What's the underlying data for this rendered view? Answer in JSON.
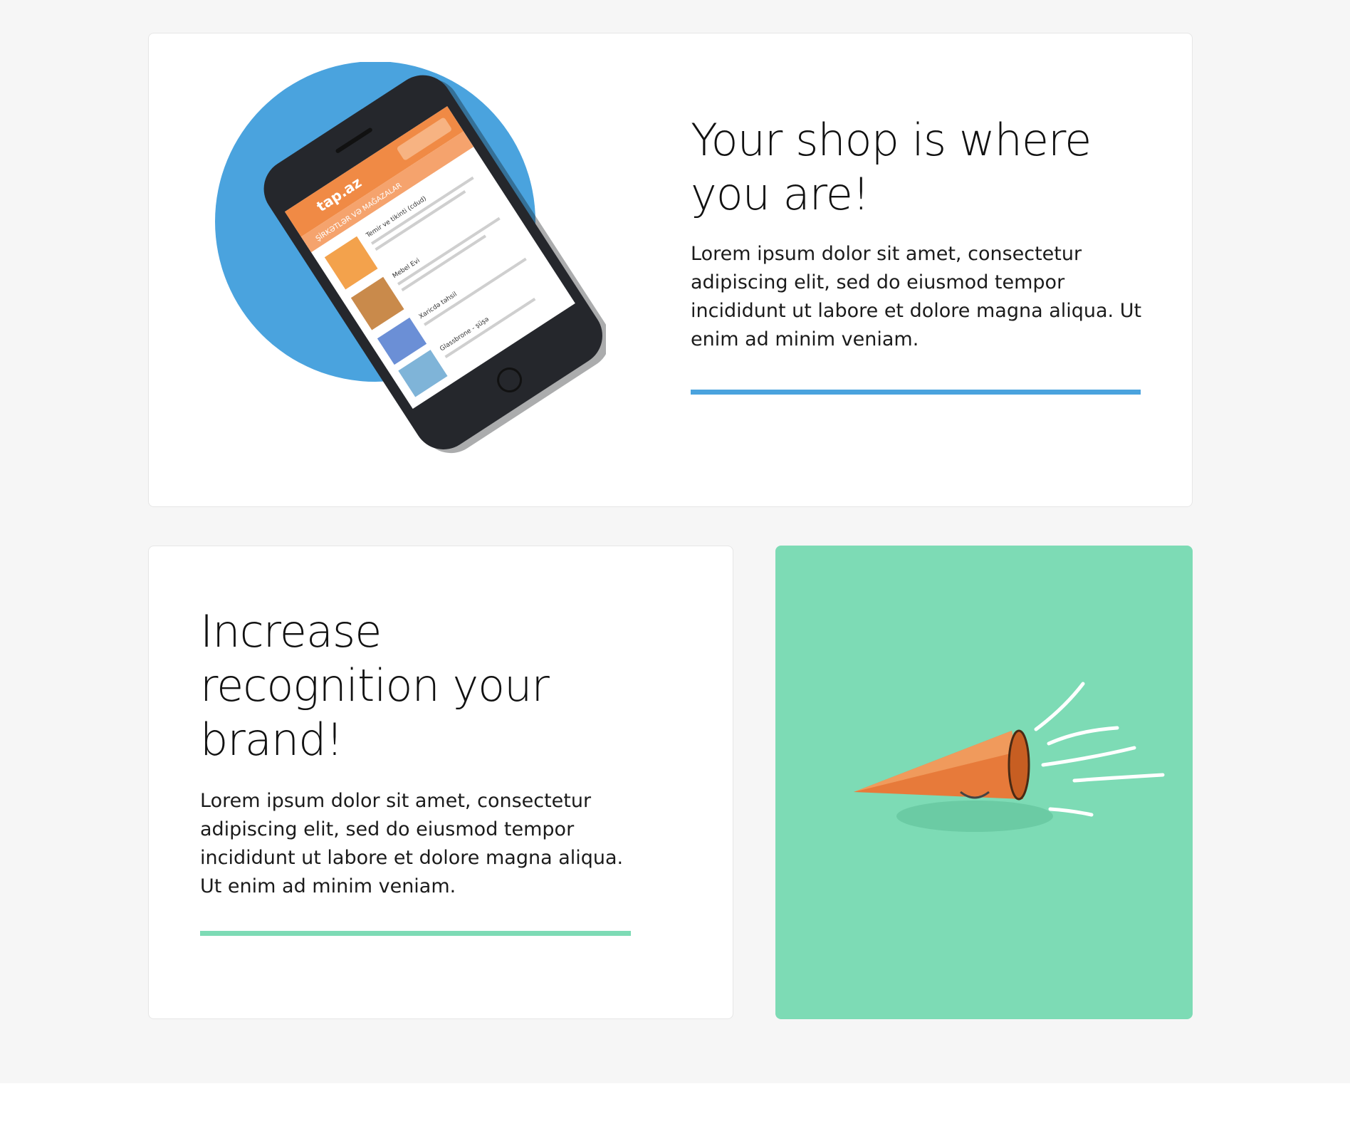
{
  "sections": {
    "shop": {
      "title": "Your shop is where you are!",
      "body": "Lorem ipsum dolor sit amet, consectetur adipiscing elit, sed do eiusmod tempor incididunt ut labore et dolore magna aliqua. Ut enim ad minim veniam.",
      "accent_color": "#4aa3de",
      "illustration": "phone-app-illustration",
      "phone_screen": {
        "brand": "tap.az",
        "nav_label": "ŞİRKƏTLƏR VƏ MAĞAZALAR",
        "listing_1": "Temir ve tikinti (cdud)",
        "listing_2": "Mebel Evi",
        "listing_3": "Xaricdə təhsil",
        "listing_4": "Glassbrone - şüşə"
      }
    },
    "brand": {
      "title": "Increase recognition your brand!",
      "body": "Lorem ipsum dolor sit amet, consectetur adipiscing elit, sed do eiusmod tempor incididunt ut labore et dolore magna aliqua. Ut enim ad minim veniam.",
      "accent_color": "#7ddbb5",
      "illustration": "megaphone-illustration"
    }
  }
}
